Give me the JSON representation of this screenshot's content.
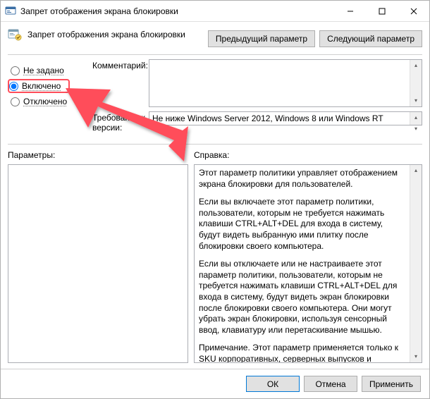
{
  "window": {
    "title": "Запрет отображения экрана блокировки"
  },
  "header": {
    "policy_title": "Запрет отображения экрана блокировки",
    "prev_btn": "Предыдущий параметр",
    "next_btn": "Следующий параметр"
  },
  "radios": {
    "not_configured": "Не задано",
    "enabled": "Включено",
    "disabled": "Отключено"
  },
  "form": {
    "comment_label": "Комментарий:",
    "comment_value": "",
    "version_label": "Требования к версии:",
    "version_value": "Не ниже Windows Server 2012, Windows 8 или Windows RT"
  },
  "panes": {
    "params_label": "Параметры:",
    "help_label": "Справка:",
    "help_p1": "Этот параметр политики управляет отображением экрана блокировки для пользователей.",
    "help_p2": "Если вы включаете этот параметр политики, пользователи, которым не требуется нажимать клавиши CTRL+ALT+DEL для входа в систему, будут видеть выбранную ими плитку после блокировки своего компьютера.",
    "help_p3": "Если вы отключаете или не настраиваете этот параметр политики, пользователи, которым не требуется нажимать клавиши CTRL+ALT+DEL для входа в систему, будут видеть экран блокировки после блокировки своего компьютера. Они могут убрать экран блокировки, используя сенсорный ввод, клавиатуру или перетаскивание мышью.",
    "help_p4": "Примечание. Этот параметр применяется только к SKU корпоративных, серверных выпусков и выпусков для образовательных учреждений."
  },
  "buttons": {
    "ok": "ОК",
    "cancel": "Отмена",
    "apply": "Применить"
  },
  "colors": {
    "highlight": "#ff4d5a",
    "accent": "#0078d7"
  }
}
